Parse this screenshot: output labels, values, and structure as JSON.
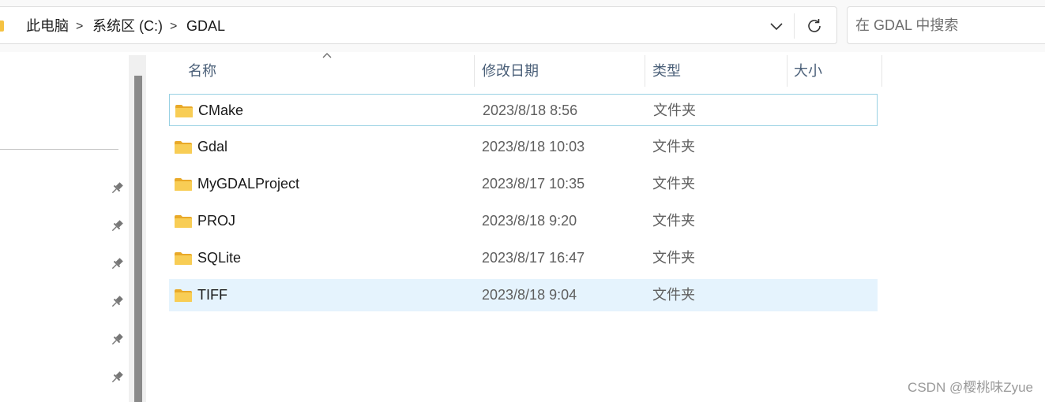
{
  "address_bar": {
    "breadcrumbs": [
      "此电脑",
      "系统区 (C:)",
      "GDAL"
    ],
    "separator": ">",
    "dropdown_icon": "chevron-down-icon",
    "refresh_icon": "refresh-icon"
  },
  "search": {
    "placeholder": "在 GDAL 中搜索"
  },
  "nav": {
    "pin_icon": "pin-icon"
  },
  "columns": {
    "name": "名称",
    "modified": "修改日期",
    "type": "类型",
    "size": "大小",
    "sort_icon": "sort-up-icon"
  },
  "files": [
    {
      "name": "CMake",
      "date": "2023/8/18 8:56",
      "type": "文件夹",
      "state": "focused"
    },
    {
      "name": "Gdal",
      "date": "2023/8/18 10:03",
      "type": "文件夹",
      "state": "normal"
    },
    {
      "name": "MyGDALProject",
      "date": "2023/8/17 10:35",
      "type": "文件夹",
      "state": "normal"
    },
    {
      "name": "PROJ",
      "date": "2023/8/18 9:20",
      "type": "文件夹",
      "state": "normal"
    },
    {
      "name": "SQLite",
      "date": "2023/8/17 16:47",
      "type": "文件夹",
      "state": "normal"
    },
    {
      "name": "TIFF",
      "date": "2023/8/18 9:04",
      "type": "文件夹",
      "state": "selected"
    }
  ],
  "watermark": "CSDN @樱桃味Zyue",
  "colors": {
    "folder": "#f5c242",
    "selection": "#e5f3fd",
    "focus_border": "#99d1e3",
    "header_text": "#4a5f78"
  }
}
